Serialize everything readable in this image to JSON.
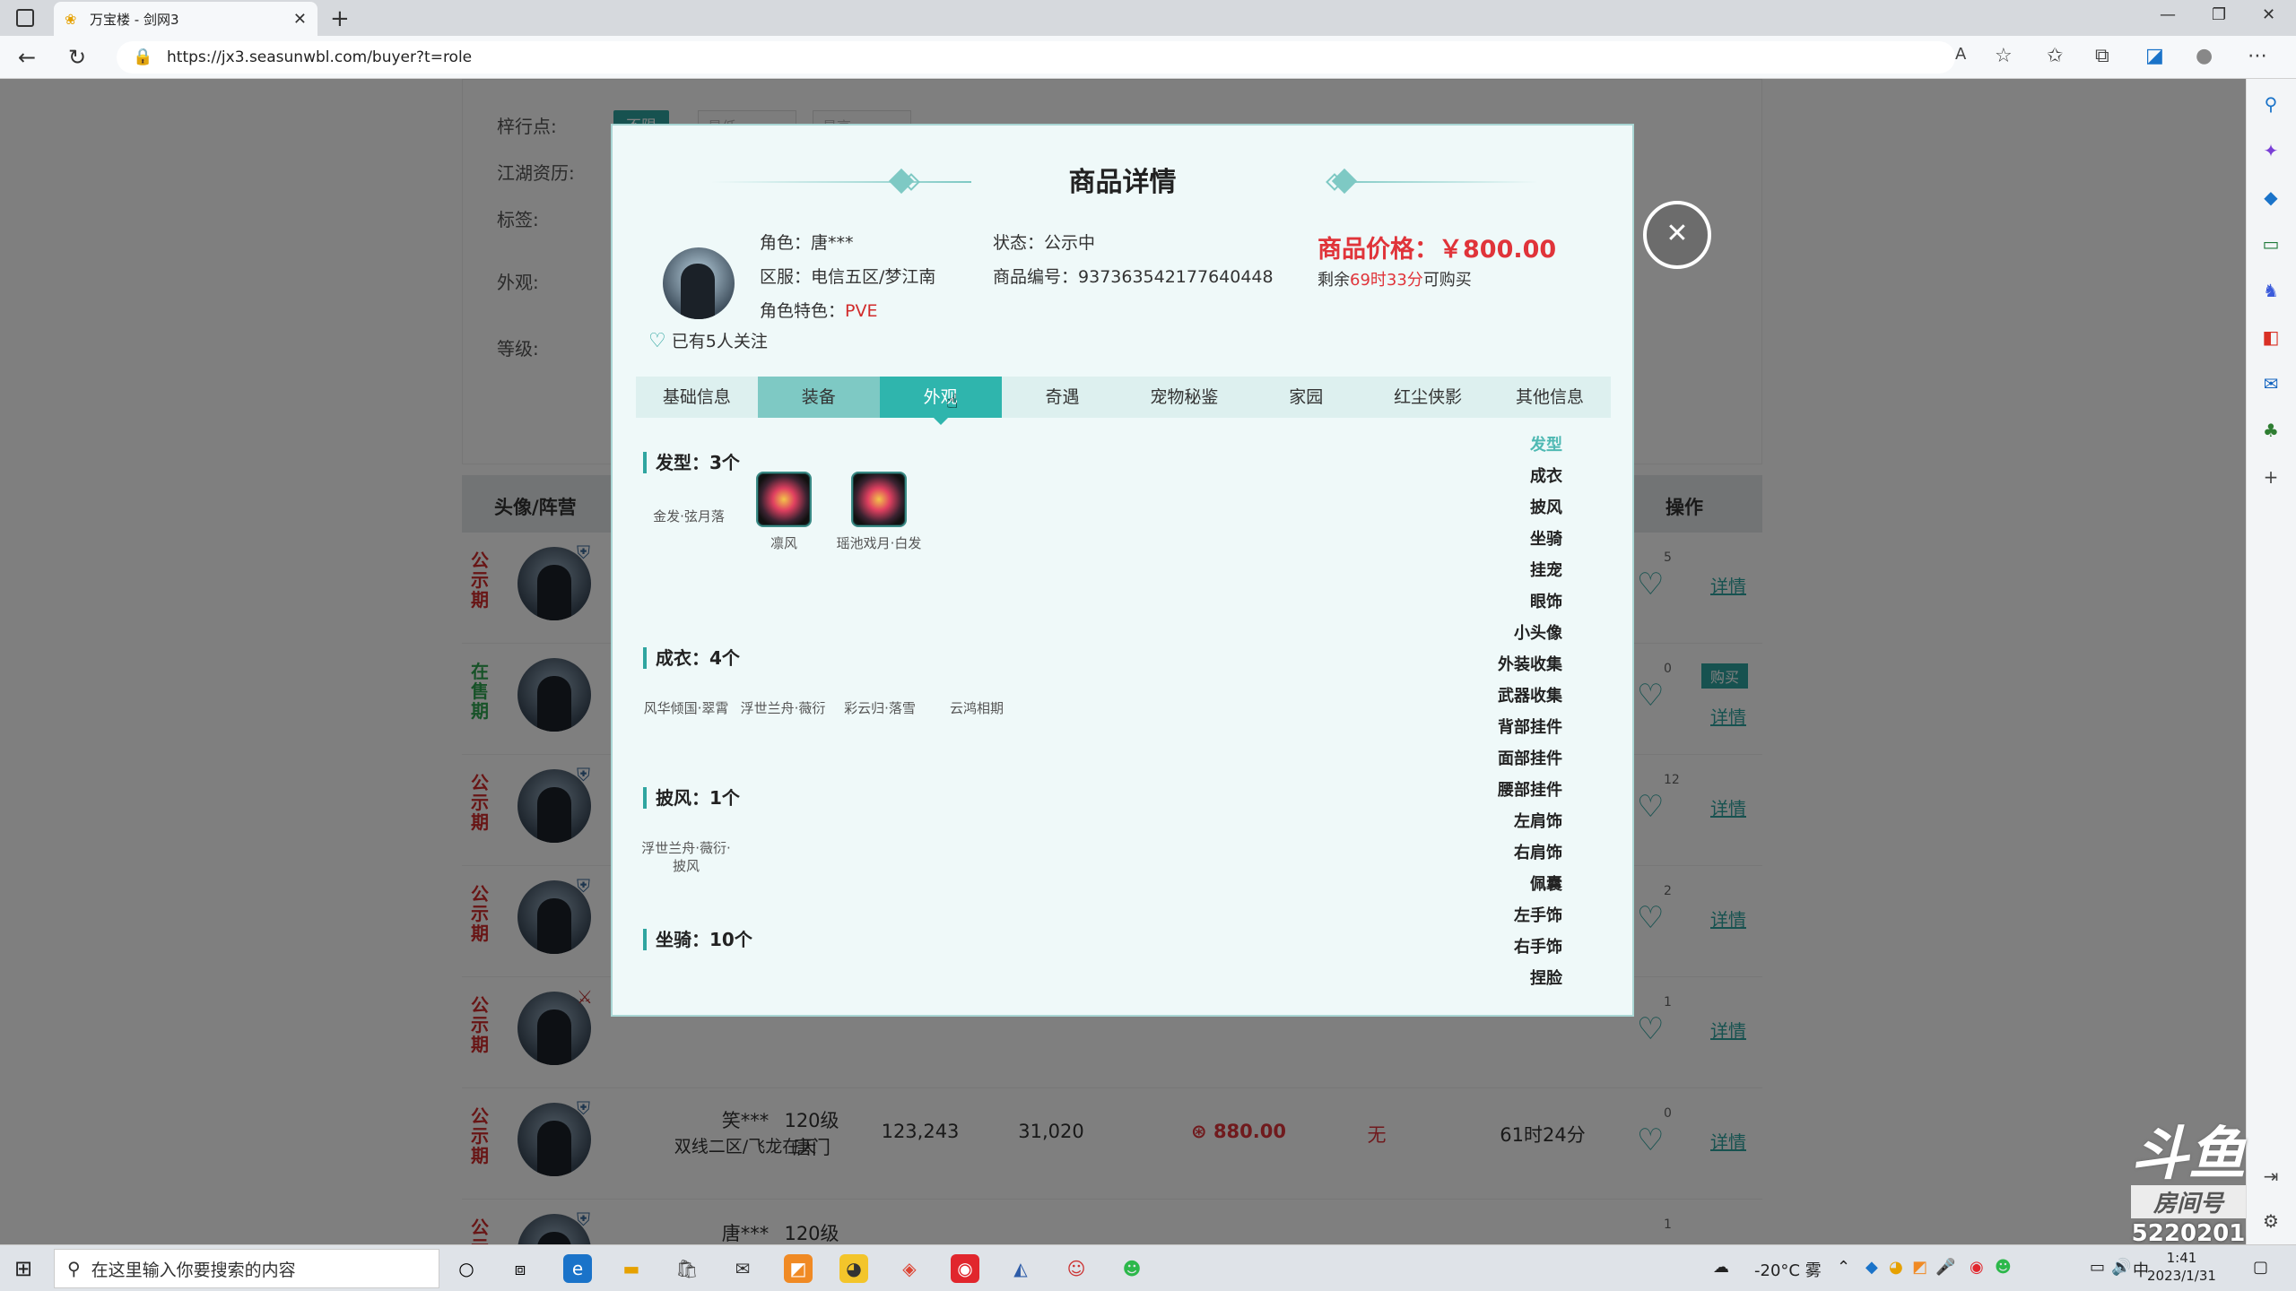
{
  "browser": {
    "tab_title": "万宝楼 - 剑网3",
    "url": "https://jx3.seasunwbl.com/buyer?t=role"
  },
  "filters": {
    "row1_label": "梓行点:",
    "row2_label": "江湖资历:",
    "row3_label": "标签:",
    "row4_label": "外观:",
    "row5_label": "等级:",
    "unlimited": "不限",
    "min_placeholder": "最低",
    "max_placeholder": "最高"
  },
  "table": {
    "head_avatar": "头像/阵营",
    "head_action": "操作",
    "rows": [
      {
        "status": "公示期",
        "status_color": "#d12b2b",
        "count": "5",
        "detail": "详情"
      },
      {
        "status": "在售期",
        "status_color": "#2fa550",
        "count": "0",
        "buy": "购买",
        "detail": "详情"
      },
      {
        "status": "公示期",
        "status_color": "#d12b2b",
        "count": "12",
        "detail": "详情"
      },
      {
        "status": "公示期",
        "status_color": "#d12b2b",
        "count": "2",
        "detail": "详情"
      },
      {
        "status": "公示期",
        "status_color": "#d12b2b",
        "count": "1",
        "detail": "详情"
      },
      {
        "status": "公示期",
        "status_color": "#d12b2b",
        "name": "笑***",
        "server": "双线二区/飞龙在天",
        "level": "120级",
        "school": "唐门",
        "score1": "123,243",
        "score2": "31,020",
        "price": "880.00",
        "mark": "无",
        "time": "61时24分",
        "count": "0",
        "detail": "详情"
      },
      {
        "status": "公示期",
        "status_color": "#d12b2b",
        "count": "1",
        "name": "唐***",
        "level": "120级"
      }
    ]
  },
  "modal": {
    "title": "商品详情",
    "role_label": "角色：",
    "role_value": "唐***",
    "server_label": "区服：",
    "server_value": "电信五区/梦江南",
    "feature_label": "角色特色：",
    "feature_value": "PVE",
    "state_label": "状态：",
    "state_value": "公示中",
    "code_label": "商品编号：",
    "code_value": "937363542177640448",
    "price_label": "商品价格：",
    "price_value": "￥800.00",
    "remain_prefix": "剩余",
    "remain_time": "69时33分",
    "remain_suffix": "可购买",
    "follow_text": "已有5人关注",
    "tabs": [
      "基础信息",
      "装备",
      "外观",
      "奇遇",
      "宠物秘鉴",
      "家园",
      "红尘侠影",
      "其他信息"
    ],
    "sections": {
      "hair": {
        "title": "发型：3个",
        "items": [
          "金发·弦月落",
          "凛风",
          "瑶池戏月·白发"
        ]
      },
      "outfit": {
        "title": "成衣：4个",
        "items": [
          "风华倾国·翠霄",
          "浮世兰舟·薇衍",
          "彩云归·落雪",
          "云鸿相期"
        ]
      },
      "cloak": {
        "title": "披风：1个",
        "items": [
          "浮世兰舟·薇衍·披风"
        ]
      },
      "mount": {
        "title": "坐骑：10个"
      }
    },
    "anchors": [
      "发型",
      "成衣",
      "披风",
      "坐骑",
      "挂宠",
      "眼饰",
      "小头像",
      "外装收集",
      "武器收集",
      "背部挂件",
      "面部挂件",
      "腰部挂件",
      "左肩饰",
      "右肩饰",
      "佩囊",
      "左手饰",
      "右手饰",
      "捏脸"
    ]
  },
  "watermark": {
    "logo": "斗鱼",
    "room": "房间号",
    "room_no": "5220201"
  },
  "taskbar": {
    "search_placeholder": "在这里输入你要搜索的内容",
    "weather": "-20°C 雾",
    "ime": "中",
    "time": "1:41",
    "date": "2023/1/31"
  },
  "colors": {
    "accent": "#2fa5a0",
    "price_red": "#e0343a"
  }
}
